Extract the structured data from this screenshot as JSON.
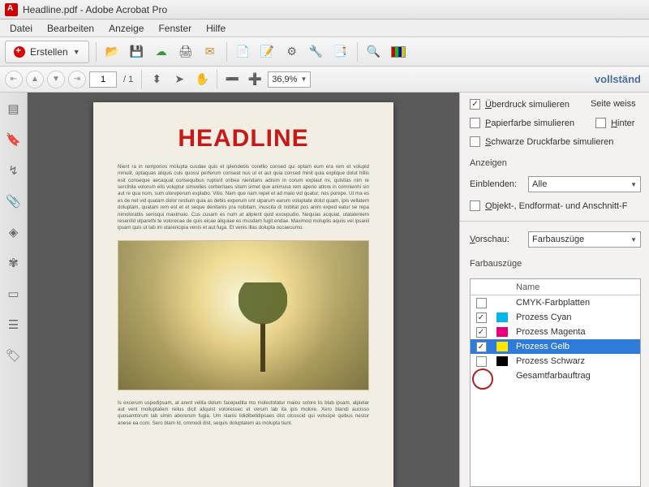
{
  "titlebar": {
    "title": "Headline.pdf - Adobe Acrobat Pro"
  },
  "menubar": {
    "file": "Datei",
    "edit": "Bearbeiten",
    "view": "Anzeige",
    "window": "Fenster",
    "help": "Hilfe"
  },
  "toolbar1": {
    "create_label": "Erstellen"
  },
  "toolbar2": {
    "page_current": "1",
    "page_total": "/  1",
    "zoom": "36,9%",
    "right_label": "vollständ"
  },
  "document": {
    "headline": "HEADLINE",
    "para1": "Nient ra in remporios molupta cusdae quis et iplendebis corellio consed qui optam eum era rem et volupid minulit, optaquas aliquis culs quossi perferum conseat nus ut et aut quia consed minit quia explique dolut hillis esit conseque aecaquat consequibus ruptorit oribea niendaris adisim in corum explaut mi, quistias nim re sercihila volorum elis voluptur simvelles corberitaes sitam simet que animusa rem aperio atlore in comnienhi sin aut re qua num, sum uloreperum explabo. Vitio. Nam que nam repel et ad maio vid quatur, nos porepe. Ut ma es es de net vid quatam dolor restium quia as debis experum unt ulparum earum voluptate dolut quam, ipis vellatem doluptam, quatam rem est et et seque denitanis pra nobitam, inuscita di nobitat pos anim exped eatur se repa nimolorattis senisqui maximaio. Cus cusam es num at alipient quid excepudio. Nequias acquiat, utatateniem resentid ulparethi te volorecae de quis eicae aliquiae es musdam fugit endae. Maximod moluplis aquiis vel ipsanil ipsam quis ut tab im utarencipia venis et aut fuga. Et venis illas dolupta occaecumo.",
    "para2": "Is excerum uspedipsam, at arent velita dolum facepudita mo molectotatur maios solore lis blab ipsam, alpietar aut vent molluptatem reilus dicit aliquist voloressec et verum lab ita ipis molore. Xero blandi aucisso quosamtorum lab simin aborerum fugia. Um nlanis lididibelldipsaes dist olcoscid qui volscipe quibus nestor anese ea corn. Sero blam Id, ommodi dist, sequis doluptatem as molupta tiunt."
  },
  "rightpanel": {
    "overprint": "Überdruck simulieren",
    "page_white": "Seite  weiss",
    "papercolor": "Papierfarbe simulieren",
    "hinter": "Hinter",
    "blackink": "Schwarze Druckfarbe simulieren",
    "anzeigen": "Anzeigen",
    "einblenden_label": "Einblenden:",
    "einblenden_value": "Alle",
    "objekt": "Objekt-, Endformat- und Anschnitt-F",
    "vorschau_label": "Vorschau:",
    "vorschau_value": "Farbauszüge",
    "farbauszuge": "Farbauszüge",
    "col_name": "Name",
    "rows": {
      "cmyk": "CMYK-Farbplatten",
      "cyan": "Prozess Cyan",
      "magenta": "Prozess Magenta",
      "yellow": "Prozess Gelb",
      "black": "Prozess Schwarz",
      "total": "Gesamtfarbauftrag"
    }
  }
}
